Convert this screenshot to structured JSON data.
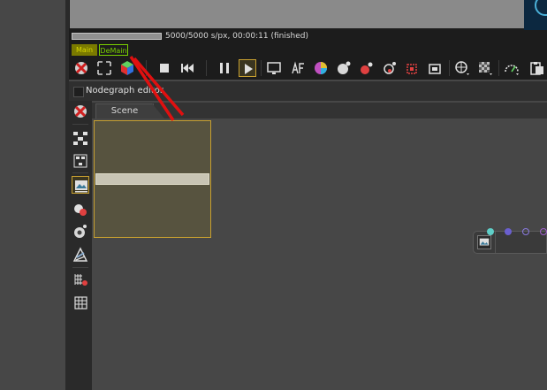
{
  "render": {
    "progress_text": "5000/5000 s/px, 00:00:11 (finished)",
    "progress_value": 1.0
  },
  "tabs": {
    "main_label": "Main",
    "demain_label": "DeMain"
  },
  "nodegraph": {
    "title": "Nodegraph editor",
    "scene_tab_label": "Scene"
  },
  "icons": {
    "toolbar": [
      "recenter-view-icon",
      "fit-view-icon",
      "color-cube-icon",
      "stop-icon",
      "restart-icon",
      "pause-icon",
      "play-icon",
      "display-icon",
      "af-icon",
      "color-wheel-icon",
      "sphere-camera-icon",
      "material-sphere-icon",
      "render-region-icon",
      "film-region-icon",
      "globe-settings-icon",
      "checker-grid-icon",
      "speed-gauge-icon",
      "clipboard-icon"
    ],
    "side": [
      "recenter-icon",
      "graph-layout-icon",
      "graph-expand-icon",
      "image-node-icon",
      "object-node-icon",
      "camera-node-icon",
      "material-node-icon",
      "chart-node-icon",
      "grid-node-icon"
    ]
  },
  "colors": {
    "accent": "#c7a030",
    "main_tab": "#7a7a00",
    "demain_tab": "#7ad000",
    "annotation": "#e01010"
  }
}
